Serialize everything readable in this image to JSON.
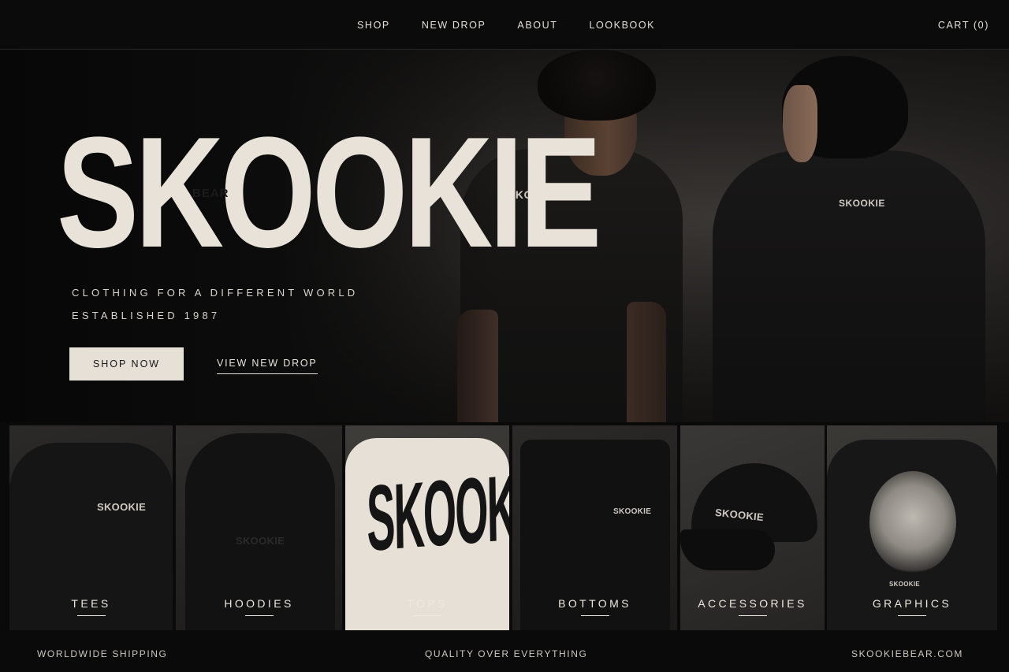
{
  "nav": {
    "links": [
      "SHOP",
      "NEW DROP",
      "ABOUT",
      "LOOKBOOK"
    ],
    "cart": "CART (0)"
  },
  "hero": {
    "brand": "SKOOKIE",
    "brand_sub": "BEAR",
    "tagline": "CLOTHING FOR A DIFFERENT WORLD",
    "established": "ESTABLISHED 1987",
    "shop_now": "SHOP NOW",
    "view_new_drop": "VIEW NEW DROP",
    "tee_print": "SKOOKIE.",
    "hoodie_print": "SKOOKIE"
  },
  "categories": [
    {
      "label": "TEES",
      "print": "SKOOKIE"
    },
    {
      "label": "HOODIES",
      "print": "SKOOKIE"
    },
    {
      "label": "TOPS",
      "print": "SKOOKIE"
    },
    {
      "label": "BOTTOMS",
      "print": "SKOOKIE"
    },
    {
      "label": "ACCESSORIES",
      "print": "SKOOKIE"
    },
    {
      "label": "GRAPHICS",
      "print": "SKOOKIE"
    }
  ],
  "footer": {
    "left": "WORLDWIDE SHIPPING",
    "center": "QUALITY OVER EVERYTHING",
    "right": "SKOOKIEBEAR.COM"
  },
  "colors": {
    "background": "#0a0a0a",
    "cream": "#e6e0d6",
    "text": "#e9e4dc"
  }
}
